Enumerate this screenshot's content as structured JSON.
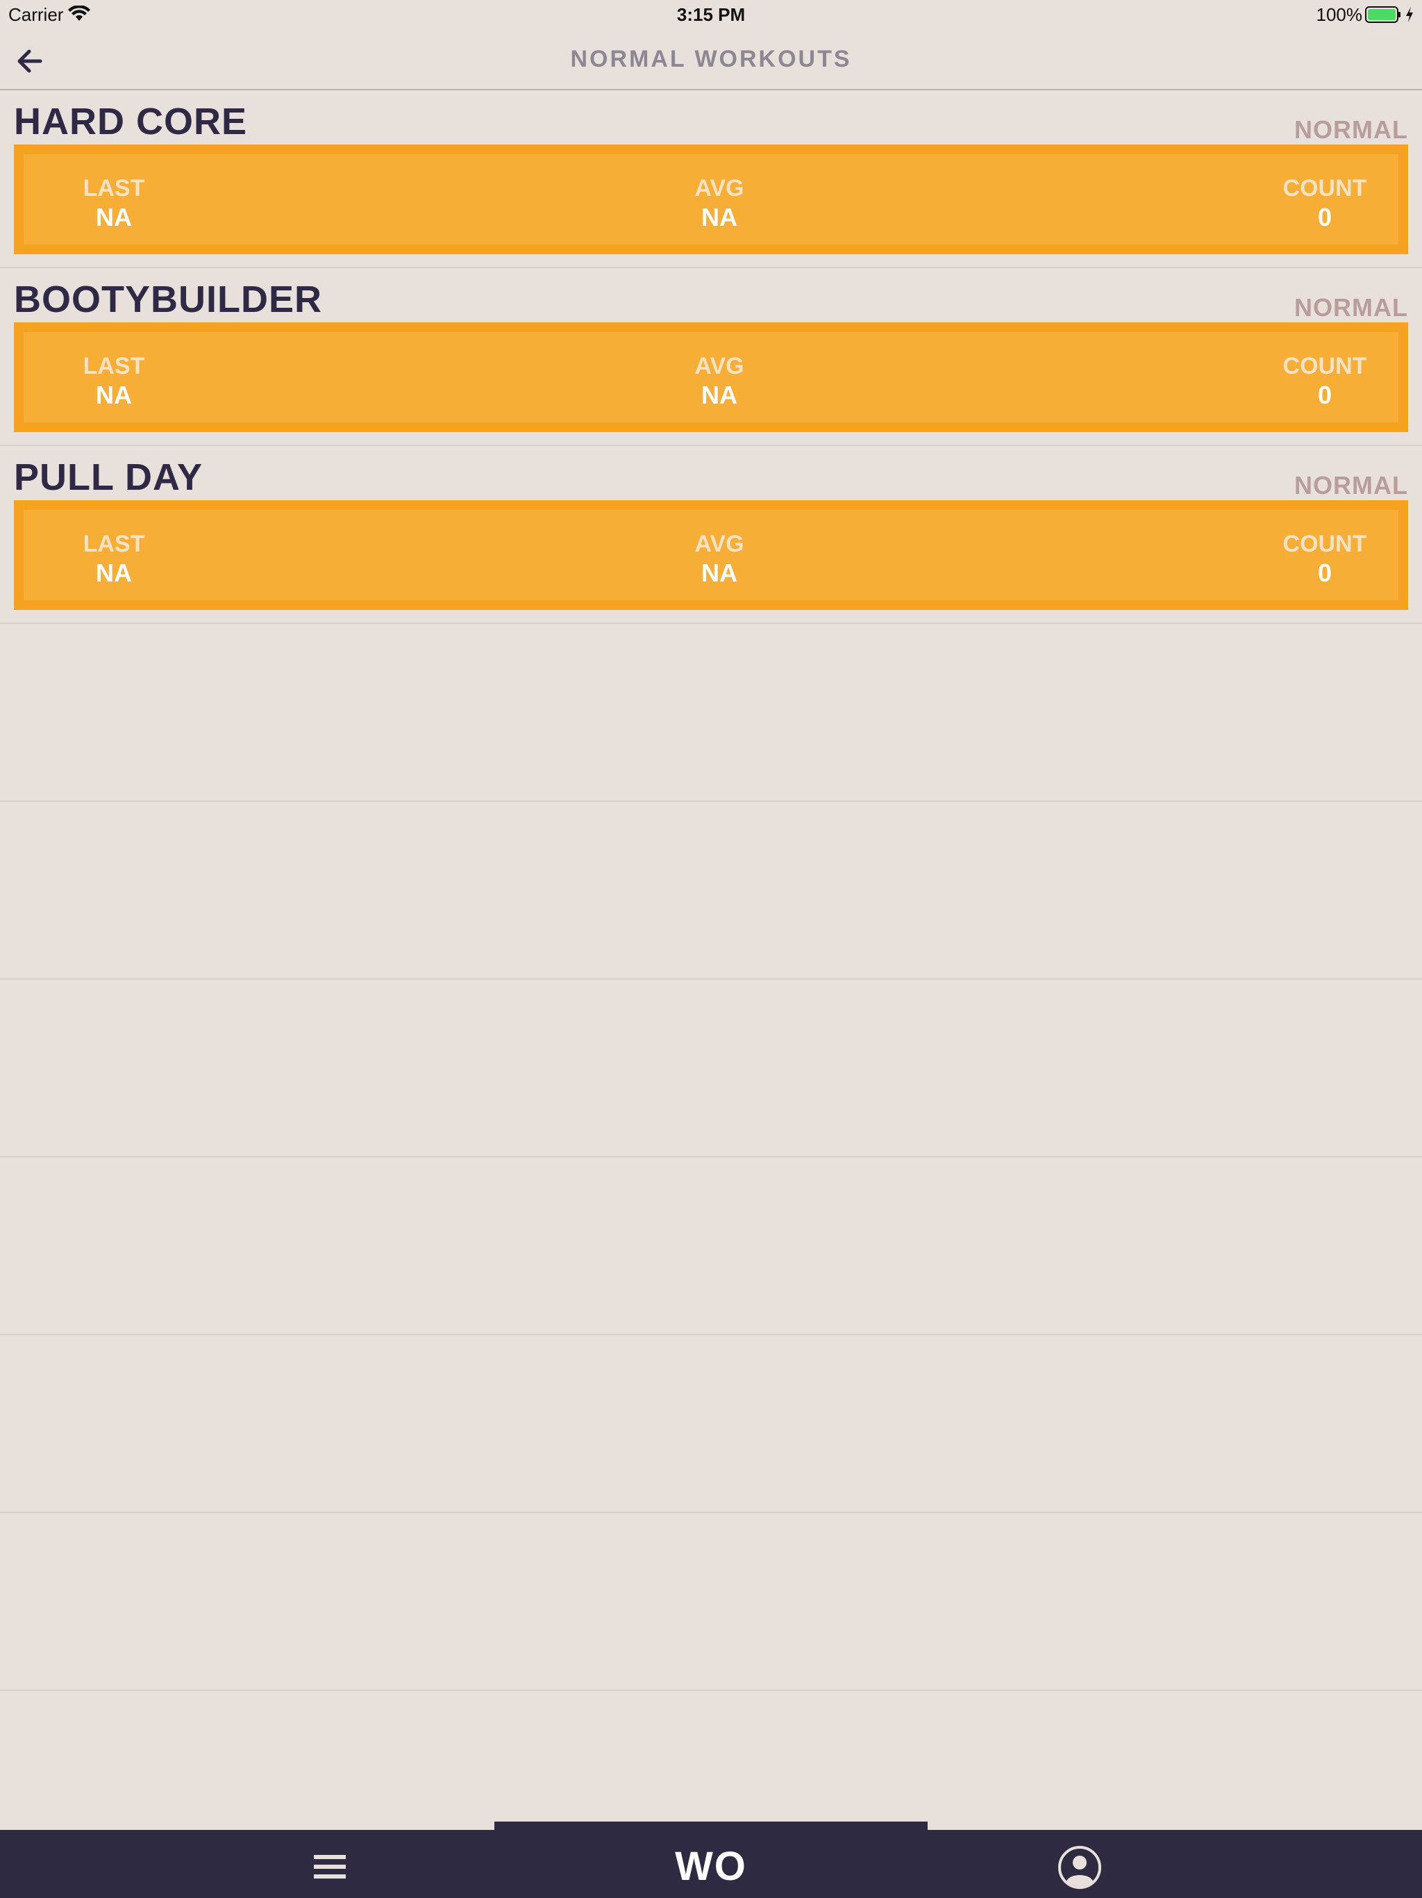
{
  "status_bar": {
    "carrier": "Carrier",
    "time": "3:15 PM",
    "battery": "100%"
  },
  "nav": {
    "title": "NORMAL WORKOUTS",
    "back_icon": "arrow-left-icon"
  },
  "workouts": [
    {
      "name": "HARD CORE",
      "type": "NORMAL",
      "stats": {
        "last_label": "LAST",
        "last_value": "NA",
        "avg_label": "AVG",
        "avg_value": "NA",
        "count_label": "COUNT",
        "count_value": "0"
      }
    },
    {
      "name": "BOOTYBUILDER",
      "type": "NORMAL",
      "stats": {
        "last_label": "LAST",
        "last_value": "NA",
        "avg_label": "AVG",
        "avg_value": "NA",
        "count_label": "COUNT",
        "count_value": "0"
      }
    },
    {
      "name": "PULL DAY",
      "type": "NORMAL",
      "stats": {
        "last_label": "LAST",
        "last_value": "NA",
        "avg_label": "AVG",
        "avg_value": "NA",
        "count_label": "COUNT",
        "count_value": "0"
      }
    }
  ],
  "tab_bar": {
    "home_label": "WO",
    "menu_icon": "hamburger-menu-icon",
    "profile_icon": "user-profile-icon"
  },
  "colors": {
    "background": "#e8e0db",
    "card_fill": "#f7ae36",
    "card_border": "#f6a221",
    "title_dark": "#2e2a45",
    "type_label": "#b99d9a",
    "tab_bar": "#2e2a42"
  }
}
